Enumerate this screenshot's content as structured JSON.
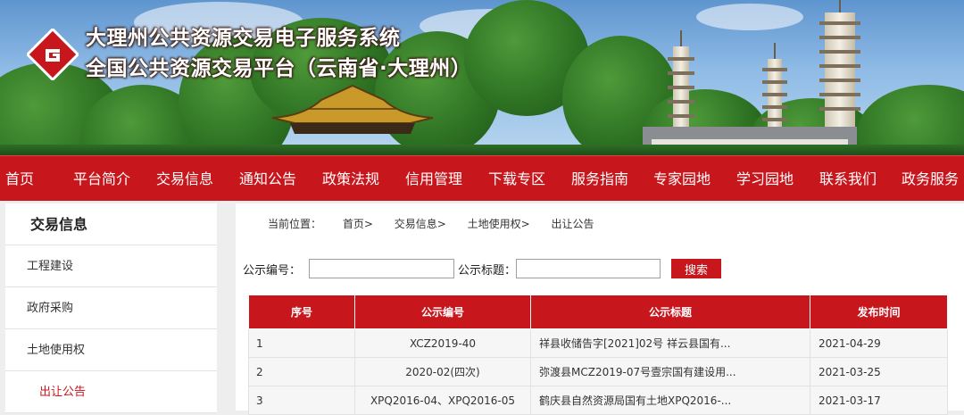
{
  "header": {
    "title_line1": "大理州公共资源交易电子服务系统",
    "title_line2": "全国公共资源交易平台（云南省·大理州）",
    "colors": {
      "brand_red": "#c8161d"
    }
  },
  "nav": {
    "items": [
      "首页",
      "平台简介",
      "交易信息",
      "通知公告",
      "政策法规",
      "信用管理",
      "下载专区",
      "服务指南",
      "专家园地",
      "学习园地",
      "联系我们",
      "政务服务"
    ]
  },
  "sidebar": {
    "title": "交易信息",
    "items": [
      "工程建设",
      "政府采购",
      "土地使用权",
      "出让公告"
    ]
  },
  "breadcrumb": {
    "prefix": "当前位置：",
    "items": [
      "首页>",
      "交易信息>",
      "土地使用权>",
      "出让公告"
    ]
  },
  "search": {
    "code_label": "公示编号：",
    "code_value": "",
    "title_label": "公示标题：",
    "title_value": "",
    "button_label": "搜索"
  },
  "table": {
    "headers": [
      "序号",
      "公示编号",
      "公示标题",
      "发布时间"
    ],
    "rows": [
      [
        "1",
        "XCZ2019-40",
        "祥县收储告字[2021]02号 祥云县国有...",
        "2021-04-29"
      ],
      [
        "2",
        "2020-02(四次)",
        "弥渡县MCZ2019-07号壹宗国有建设用...",
        "2021-03-25"
      ],
      [
        "3",
        "XPQ2016-04、XPQ2016-05",
        "鹤庆县自然资源局国有土地XPQ2016-...",
        "2021-03-17"
      ]
    ]
  }
}
